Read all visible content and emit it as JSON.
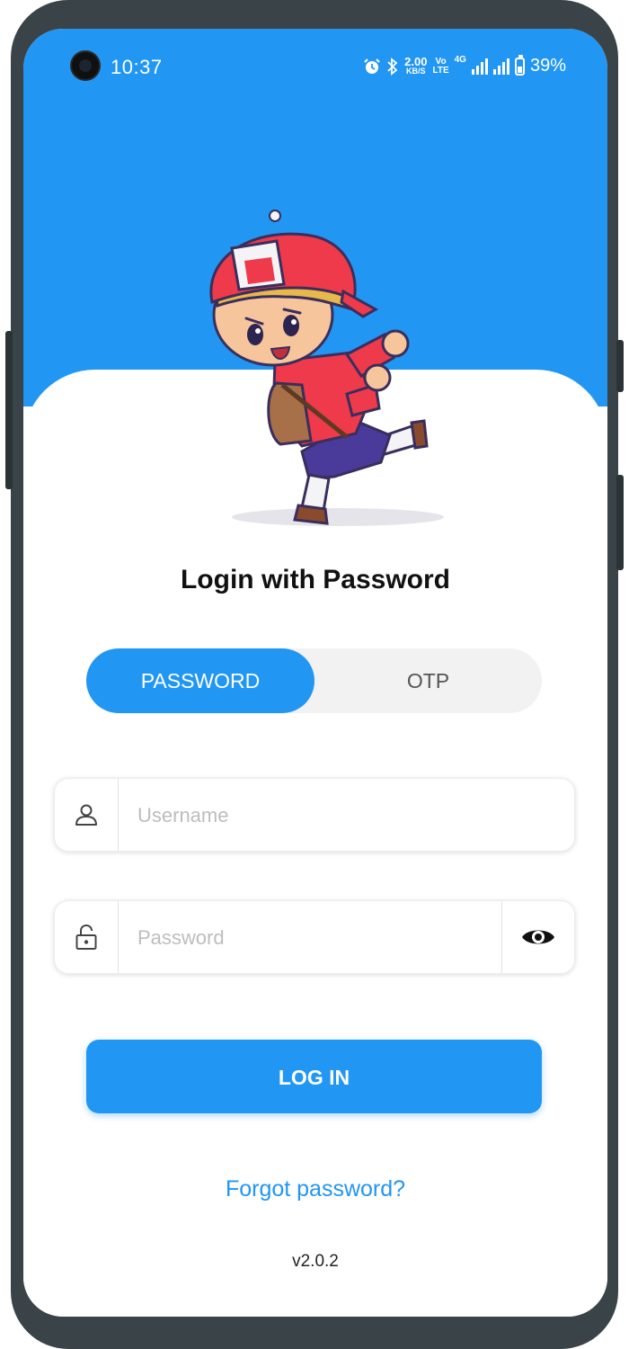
{
  "status_bar": {
    "time": "10:37",
    "net_speed_top": "2.00",
    "net_speed_bottom": "KB/S",
    "volte_top": "Vo",
    "volte_bottom": "LTE",
    "network": "4G",
    "battery": "39%"
  },
  "header": {
    "title": "Login with Password"
  },
  "tabs": [
    {
      "label": "PASSWORD",
      "active": true
    },
    {
      "label": "OTP",
      "active": false
    }
  ],
  "form": {
    "username_placeholder": "Username",
    "username_value": "",
    "password_placeholder": "Password",
    "password_value": ""
  },
  "actions": {
    "login_label": "LOG IN",
    "forgot_label": "Forgot password?"
  },
  "footer": {
    "version": "v2.0.2"
  },
  "colors": {
    "primary": "#2196f3",
    "frame": "#3a4347"
  },
  "icons": [
    "user-icon",
    "lock-icon",
    "eye-icon",
    "alarm-icon",
    "bluetooth-icon",
    "signal-icon",
    "battery-icon"
  ]
}
